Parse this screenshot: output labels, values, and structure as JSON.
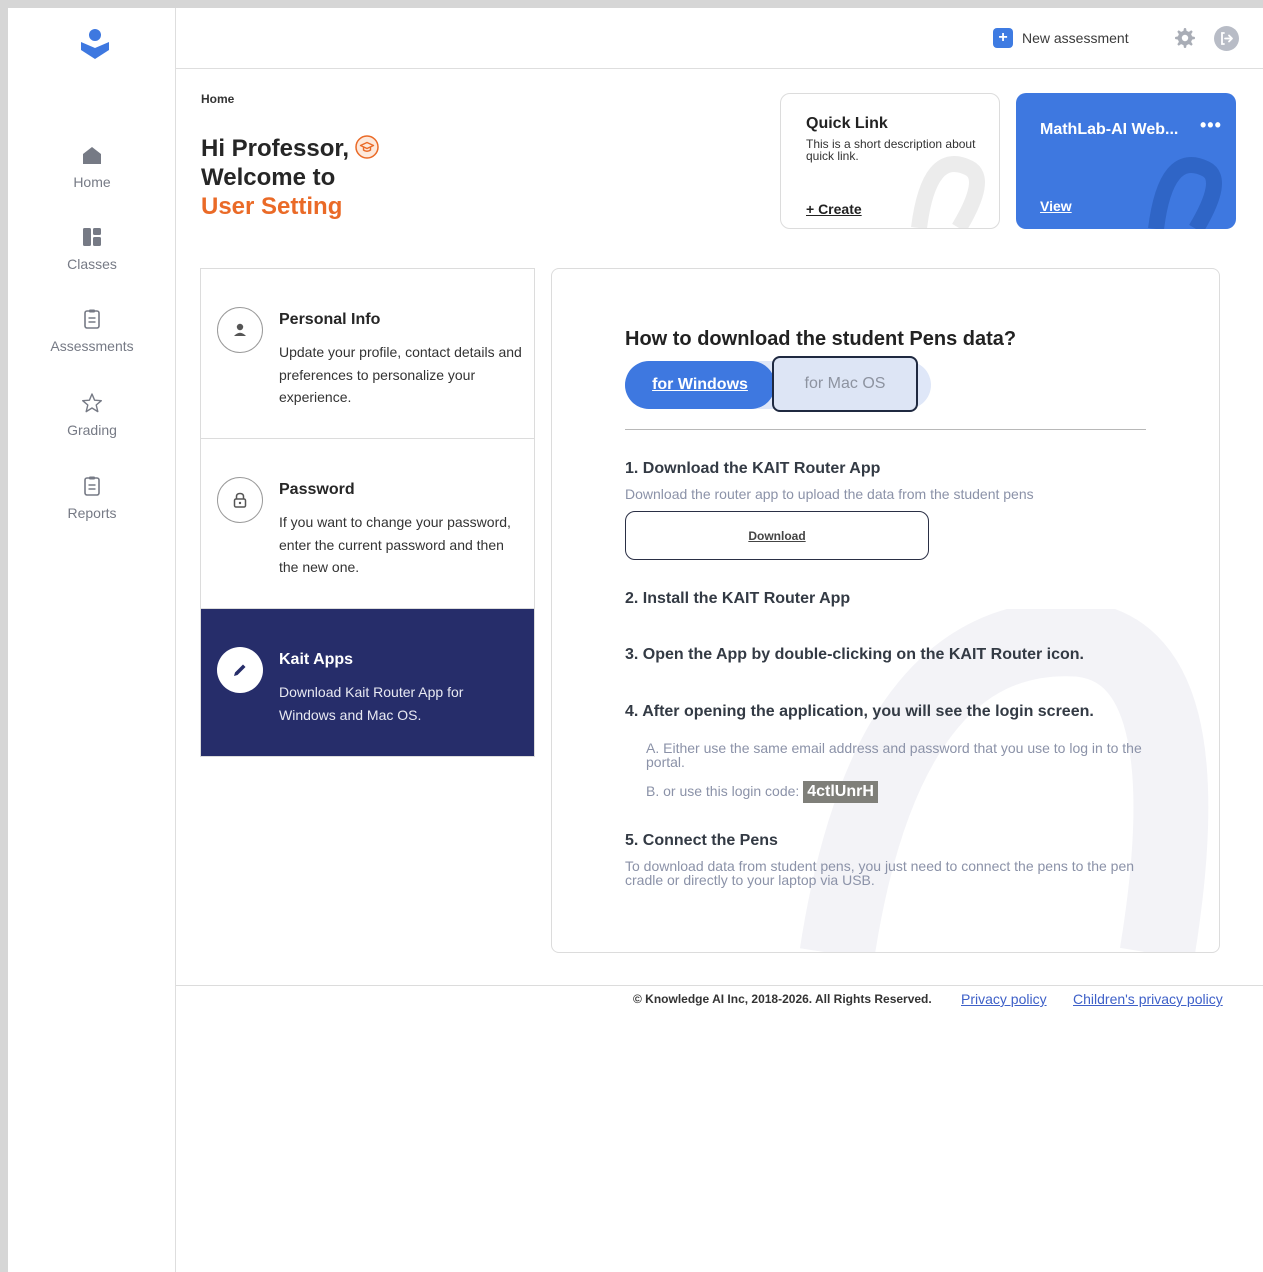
{
  "sidebar": {
    "items": [
      {
        "label": "Home",
        "icon": "home-icon"
      },
      {
        "label": "Classes",
        "icon": "classes-icon"
      },
      {
        "label": "Assessments",
        "icon": "clipboard-icon"
      },
      {
        "label": "Grading",
        "icon": "star-icon"
      },
      {
        "label": "Reports",
        "icon": "clipboard-icon"
      }
    ]
  },
  "header": {
    "new_assessment_label": "New assessment",
    "plus": "+"
  },
  "breadcrumb": "Home",
  "greeting": {
    "line1": "Hi Professor,",
    "line2": "Welcome to",
    "line3": "User Setting"
  },
  "quick_link": {
    "title": "Quick Link",
    "description": "This is a short description about quick link.",
    "create_label": "+ Create"
  },
  "featured_card": {
    "title": "MathLab-AI Web...",
    "more": "•••",
    "view_label": "View"
  },
  "settings_menu": [
    {
      "title": "Personal Info",
      "description": "Update your profile, contact details and preferences to personalize your experience.",
      "icon": "user-icon"
    },
    {
      "title": "Password",
      "description": "If you want to change your password, enter the current password and then the new one.",
      "icon": "lock-icon"
    },
    {
      "title": "Kait Apps",
      "description": "Download Kait Router App for Windows and Mac OS.",
      "icon": "pen-icon",
      "active": true
    }
  ],
  "download_panel": {
    "title": "How to download the student Pens data?",
    "tabs": {
      "windows": "for Windows",
      "mac": "for Mac OS",
      "selected": "windows"
    },
    "step1": {
      "title": "1. Download the KAIT Router App",
      "subtitle": "Download the router app to upload the data from the student pens",
      "button": "Download"
    },
    "step2": {
      "title": "2. Install the KAIT Router App"
    },
    "step3": {
      "title": "3. Open the App by double-clicking on the KAIT Router icon."
    },
    "step4": {
      "title": "4. After opening the application, you will see the login screen.",
      "option_a": "A. Either use the same email address and password that you use to log in to the portal.",
      "option_b": "B. or use this login code:",
      "login_code": "4ctlUnrH"
    },
    "step5": {
      "title": "5. Connect the Pens",
      "subtitle": "To download data from student pens, you just need to connect the pens to the pen cradle or directly to your laptop via USB."
    }
  },
  "footer": {
    "copyright": "© Knowledge AI Inc, 2018-2026. All Rights Reserved.",
    "privacy": "Privacy policy",
    "children_privacy": "Children's privacy policy"
  },
  "colors": {
    "brand_blue": "#3e78e0",
    "accent_orange": "#ea6a27",
    "active_navy": "#262d6a"
  }
}
